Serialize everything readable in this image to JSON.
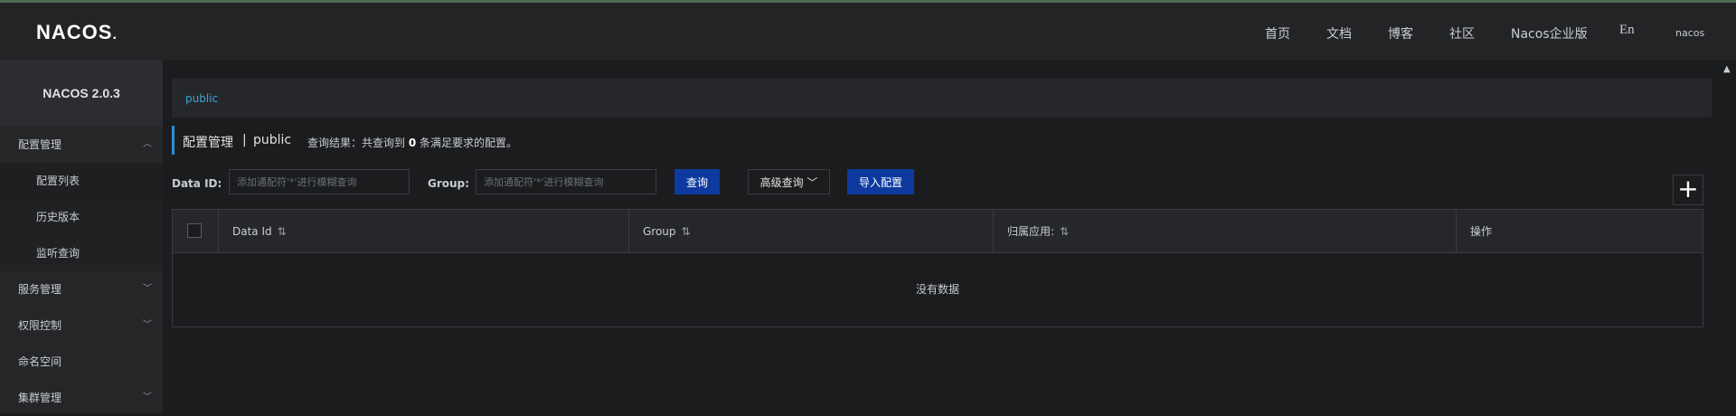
{
  "brand": {
    "logo": "NACOS",
    "logo_dot": "."
  },
  "header": {
    "nav": [
      "首页",
      "文档",
      "博客",
      "社区",
      "Nacos企业版"
    ],
    "lang": "En",
    "user": "nacos"
  },
  "sidebar": {
    "title": "NACOS 2.0.3",
    "items": [
      {
        "label": "配置管理",
        "type": "group",
        "expanded": true
      },
      {
        "label": "配置列表",
        "type": "sub"
      },
      {
        "label": "历史版本",
        "type": "sub"
      },
      {
        "label": "监听查询",
        "type": "sub"
      },
      {
        "label": "服务管理",
        "type": "group",
        "expanded": false
      },
      {
        "label": "权限控制",
        "type": "group",
        "expanded": false
      },
      {
        "label": "命名空间",
        "type": "item"
      },
      {
        "label": "集群管理",
        "type": "group",
        "expanded": false
      }
    ]
  },
  "namespace": {
    "current": "public"
  },
  "page": {
    "title": "配置管理",
    "separator": "|",
    "namespace": "public",
    "result_prefix": "查询结果：共查询到",
    "result_count": "0",
    "result_suffix": "条满足要求的配置。"
  },
  "filters": {
    "data_id_label": "Data ID:",
    "data_id_placeholder": "添加通配符'*'进行模糊查询",
    "data_id_value": "",
    "group_label": "Group:",
    "group_placeholder": "添加通配符'*'进行模糊查询",
    "group_value": "",
    "search_button": "查询",
    "advanced_button": "高级查询",
    "import_button": "导入配置",
    "add_button": "+"
  },
  "table": {
    "columns": [
      "Data Id",
      "Group",
      "归属应用:",
      "操作"
    ],
    "empty_text": "没有数据",
    "rows": []
  },
  "colors": {
    "accent": "#0e3aa0",
    "link": "#3aa5d8",
    "title_bar": "#2e8ed1"
  }
}
